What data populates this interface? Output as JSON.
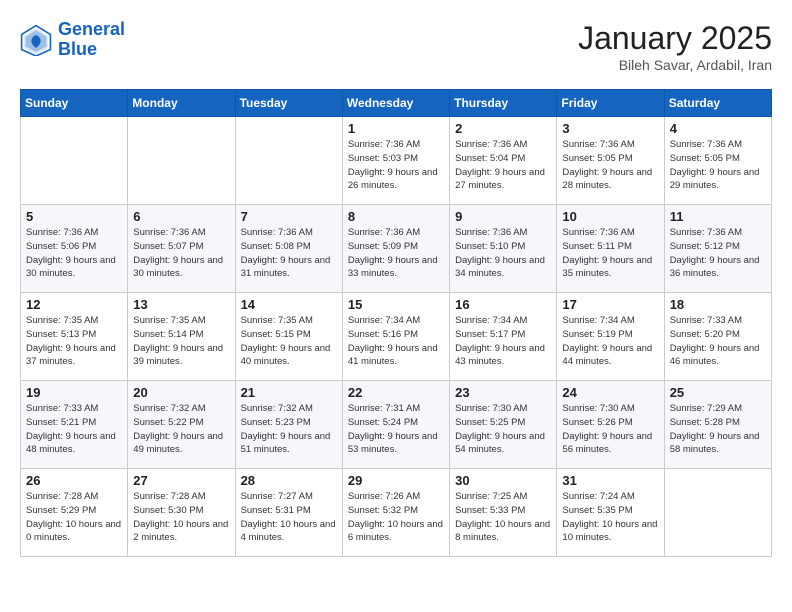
{
  "header": {
    "logo_line1": "General",
    "logo_line2": "Blue",
    "month": "January 2025",
    "location": "Bileh Savar, Ardabil, Iran"
  },
  "weekdays": [
    "Sunday",
    "Monday",
    "Tuesday",
    "Wednesday",
    "Thursday",
    "Friday",
    "Saturday"
  ],
  "weeks": [
    [
      {
        "day": null
      },
      {
        "day": null
      },
      {
        "day": null
      },
      {
        "day": "1",
        "sunrise": "7:36 AM",
        "sunset": "5:03 PM",
        "daylight": "9 hours and 26 minutes."
      },
      {
        "day": "2",
        "sunrise": "7:36 AM",
        "sunset": "5:04 PM",
        "daylight": "9 hours and 27 minutes."
      },
      {
        "day": "3",
        "sunrise": "7:36 AM",
        "sunset": "5:05 PM",
        "daylight": "9 hours and 28 minutes."
      },
      {
        "day": "4",
        "sunrise": "7:36 AM",
        "sunset": "5:05 PM",
        "daylight": "9 hours and 29 minutes."
      }
    ],
    [
      {
        "day": "5",
        "sunrise": "7:36 AM",
        "sunset": "5:06 PM",
        "daylight": "9 hours and 30 minutes."
      },
      {
        "day": "6",
        "sunrise": "7:36 AM",
        "sunset": "5:07 PM",
        "daylight": "9 hours and 30 minutes."
      },
      {
        "day": "7",
        "sunrise": "7:36 AM",
        "sunset": "5:08 PM",
        "daylight": "9 hours and 31 minutes."
      },
      {
        "day": "8",
        "sunrise": "7:36 AM",
        "sunset": "5:09 PM",
        "daylight": "9 hours and 33 minutes."
      },
      {
        "day": "9",
        "sunrise": "7:36 AM",
        "sunset": "5:10 PM",
        "daylight": "9 hours and 34 minutes."
      },
      {
        "day": "10",
        "sunrise": "7:36 AM",
        "sunset": "5:11 PM",
        "daylight": "9 hours and 35 minutes."
      },
      {
        "day": "11",
        "sunrise": "7:36 AM",
        "sunset": "5:12 PM",
        "daylight": "9 hours and 36 minutes."
      }
    ],
    [
      {
        "day": "12",
        "sunrise": "7:35 AM",
        "sunset": "5:13 PM",
        "daylight": "9 hours and 37 minutes."
      },
      {
        "day": "13",
        "sunrise": "7:35 AM",
        "sunset": "5:14 PM",
        "daylight": "9 hours and 39 minutes."
      },
      {
        "day": "14",
        "sunrise": "7:35 AM",
        "sunset": "5:15 PM",
        "daylight": "9 hours and 40 minutes."
      },
      {
        "day": "15",
        "sunrise": "7:34 AM",
        "sunset": "5:16 PM",
        "daylight": "9 hours and 41 minutes."
      },
      {
        "day": "16",
        "sunrise": "7:34 AM",
        "sunset": "5:17 PM",
        "daylight": "9 hours and 43 minutes."
      },
      {
        "day": "17",
        "sunrise": "7:34 AM",
        "sunset": "5:19 PM",
        "daylight": "9 hours and 44 minutes."
      },
      {
        "day": "18",
        "sunrise": "7:33 AM",
        "sunset": "5:20 PM",
        "daylight": "9 hours and 46 minutes."
      }
    ],
    [
      {
        "day": "19",
        "sunrise": "7:33 AM",
        "sunset": "5:21 PM",
        "daylight": "9 hours and 48 minutes."
      },
      {
        "day": "20",
        "sunrise": "7:32 AM",
        "sunset": "5:22 PM",
        "daylight": "9 hours and 49 minutes."
      },
      {
        "day": "21",
        "sunrise": "7:32 AM",
        "sunset": "5:23 PM",
        "daylight": "9 hours and 51 minutes."
      },
      {
        "day": "22",
        "sunrise": "7:31 AM",
        "sunset": "5:24 PM",
        "daylight": "9 hours and 53 minutes."
      },
      {
        "day": "23",
        "sunrise": "7:30 AM",
        "sunset": "5:25 PM",
        "daylight": "9 hours and 54 minutes."
      },
      {
        "day": "24",
        "sunrise": "7:30 AM",
        "sunset": "5:26 PM",
        "daylight": "9 hours and 56 minutes."
      },
      {
        "day": "25",
        "sunrise": "7:29 AM",
        "sunset": "5:28 PM",
        "daylight": "9 hours and 58 minutes."
      }
    ],
    [
      {
        "day": "26",
        "sunrise": "7:28 AM",
        "sunset": "5:29 PM",
        "daylight": "10 hours and 0 minutes."
      },
      {
        "day": "27",
        "sunrise": "7:28 AM",
        "sunset": "5:30 PM",
        "daylight": "10 hours and 2 minutes."
      },
      {
        "day": "28",
        "sunrise": "7:27 AM",
        "sunset": "5:31 PM",
        "daylight": "10 hours and 4 minutes."
      },
      {
        "day": "29",
        "sunrise": "7:26 AM",
        "sunset": "5:32 PM",
        "daylight": "10 hours and 6 minutes."
      },
      {
        "day": "30",
        "sunrise": "7:25 AM",
        "sunset": "5:33 PM",
        "daylight": "10 hours and 8 minutes."
      },
      {
        "day": "31",
        "sunrise": "7:24 AM",
        "sunset": "5:35 PM",
        "daylight": "10 hours and 10 minutes."
      },
      {
        "day": null
      }
    ]
  ]
}
